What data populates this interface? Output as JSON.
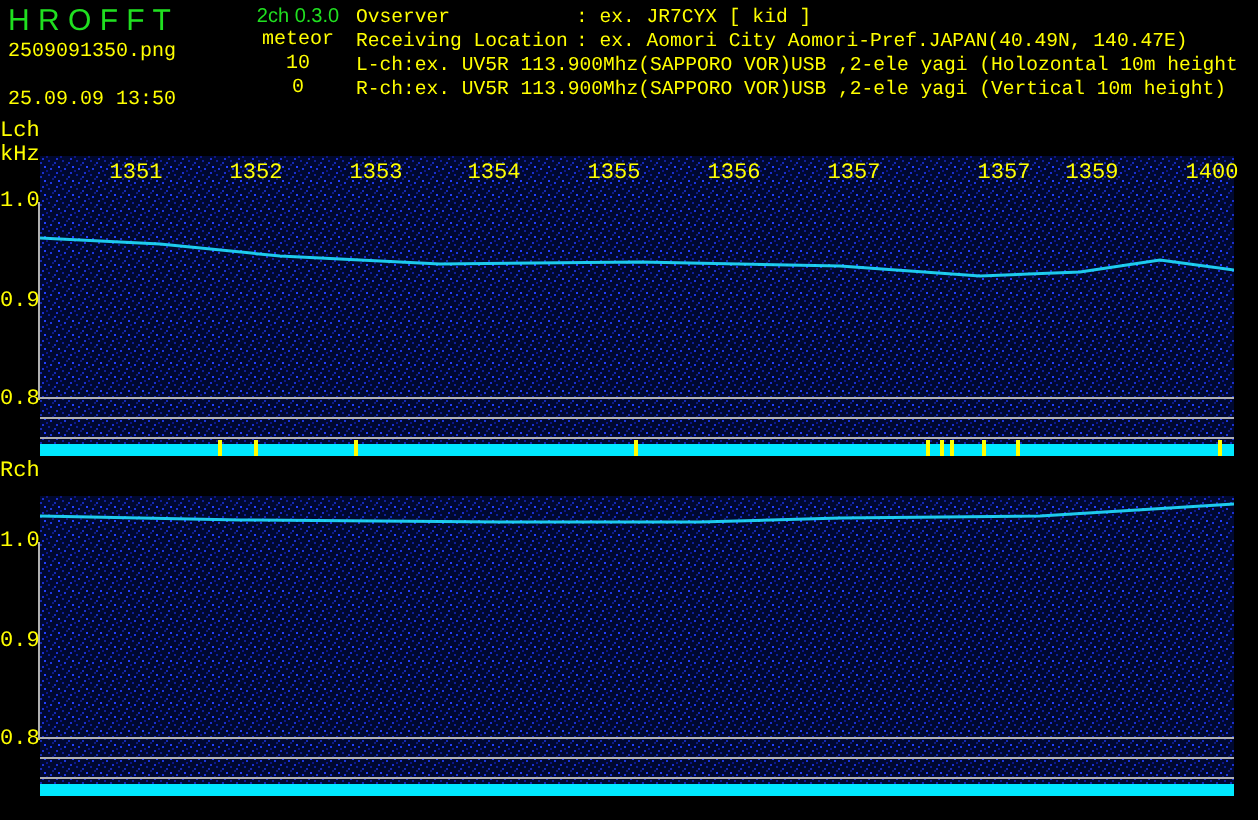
{
  "app": {
    "title": "H R O F F T",
    "version": "2ch 0.3.0",
    "filename": "2509091350.png",
    "datetime": "25.09.09 13:50",
    "meteor_label": "meteor",
    "meteor_counts": [
      "10",
      "0"
    ]
  },
  "info": [
    {
      "kind": "field",
      "label": "Ovserver",
      "value": ": ex. JR7CYX [ kid ]"
    },
    {
      "kind": "field",
      "label": "Receiving Location",
      "value": ": ex. Aomori City Aomori-Pref.JAPAN(40.49N, 140.47E)"
    },
    {
      "kind": "line",
      "text": "L-ch:ex. UV5R 113.900Mhz(SAPPORO VOR)USB ,2-ele yagi (Holozontal 10m height"
    },
    {
      "kind": "line",
      "text": "R-ch:ex. UV5R 113.900Mhz(SAPPORO VOR)USB ,2-ele yagi (Vertical 10m height)"
    }
  ],
  "panels": [
    {
      "channel": "Lch",
      "unit": "kHz",
      "yticks": [
        "1.0",
        "0.9",
        "0.8"
      ],
      "times": [
        "1351",
        "1352",
        "1353",
        "1354",
        "1355",
        "1356",
        "1357",
        "1357",
        "1359",
        "1400"
      ]
    },
    {
      "channel": "Rch",
      "yticks": [
        "1.0",
        "0.9",
        "0.8"
      ]
    }
  ]
}
